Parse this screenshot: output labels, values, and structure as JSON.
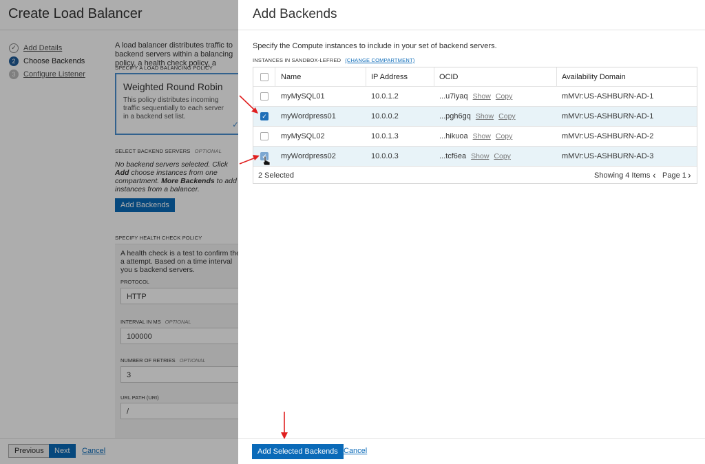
{
  "base": {
    "title": "Create Load Balancer",
    "steps": [
      {
        "num": "✓",
        "label": "Add Details"
      },
      {
        "num": "2",
        "label": "Choose Backends"
      },
      {
        "num": "3",
        "label": "Configure Listener"
      }
    ],
    "intro": "A load balancer distributes traffic to backend servers within a balancing policy, a health check policy, a",
    "policy_label": "SPECIFY A LOAD BALANCING POLICY",
    "policy": {
      "title": "Weighted Round Robin",
      "description": "This policy distributes incoming traffic sequentially to each server in a backend set list."
    },
    "backend_servers_label": "SELECT BACKEND SERVERS",
    "optional": "OPTIONAL",
    "no_backends_text_1": "No backend servers selected. Click ",
    "no_backends_bold_1": "Add",
    "no_backends_text_2": " choose instances from one compartment. ",
    "no_backends_bold_2": "More Backends",
    "no_backends_text_3": " to add instances from a balancer.",
    "add_backends_label": "Add Backends",
    "health_label": "SPECIFY HEALTH CHECK POLICY",
    "health_desc": "A health check is a test to confirm the a attempt. Based on a time interval you s backend servers.",
    "protocol_label": "PROTOCOL",
    "protocol_value": "HTTP",
    "interval_label": "INTERVAL IN MS",
    "interval_value": "100000",
    "retries_label": "NUMBER OF RETRIES",
    "retries_value": "3",
    "url_label": "URL PATH (URI)",
    "url_value": "/",
    "previous_label": "Previous",
    "next_label": "Next",
    "cancel_label": "Cancel"
  },
  "panel": {
    "title": "Add Backends",
    "description": "Specify the Compute instances to include in your set of backend servers.",
    "instances_label": "INSTANCES IN SANDBOX-LEFRED",
    "change_compartment": "(CHANGE COMPARTMENT)",
    "columns": [
      "Name",
      "IP Address",
      "OCID",
      "Availability Domain"
    ],
    "rows": [
      {
        "name": "myMySQL01",
        "ip": "10.0.1.2",
        "ocid": "...u7iyaq",
        "ad": "mMVr:US-ASHBURN-AD-1",
        "selected": false
      },
      {
        "name": "myWordpress01",
        "ip": "10.0.0.2",
        "ocid": "...pgh6gq",
        "ad": "mMVr:US-ASHBURN-AD-1",
        "selected": true
      },
      {
        "name": "myMySQL02",
        "ip": "10.0.1.3",
        "ocid": "...hikuoa",
        "ad": "mMVr:US-ASHBURN-AD-2",
        "selected": false
      },
      {
        "name": "myWordpress02",
        "ip": "10.0.0.3",
        "ocid": "...tcf6ea",
        "ad": "mMVr:US-ASHBURN-AD-3",
        "selected": true
      }
    ],
    "show_label": "Show",
    "copy_label": "Copy",
    "selected_count": "2 Selected",
    "showing": "Showing 4 Items",
    "page": "Page 1",
    "add_selected_label": "Add Selected Backends",
    "cancel_label": "Cancel"
  },
  "colors": {
    "primary": "#0a6ab8",
    "annotation_arrow": "#e02020",
    "selected_row": "#e8f3f8"
  }
}
